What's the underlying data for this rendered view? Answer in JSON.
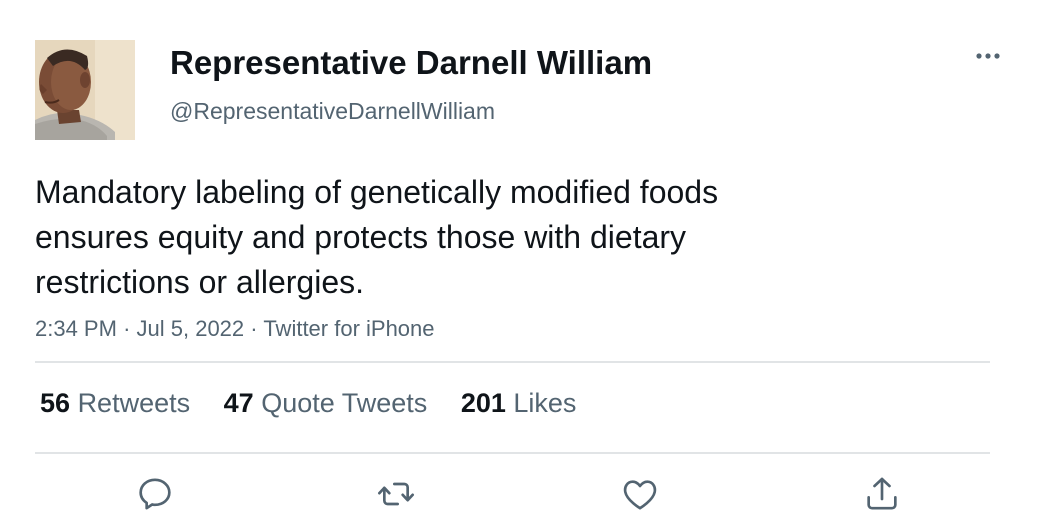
{
  "author": {
    "display_name": "Representative Darnell William",
    "handle": "@RepresentativeDarnellWilliam"
  },
  "tweet": {
    "text": "Mandatory labeling of genetically modified foods ensures equity and protects those with dietary restrictions or allergies.",
    "time": "2:34 PM",
    "separator": "·",
    "date": "Jul 5, 2022",
    "source": "Twitter for iPhone"
  },
  "stats": {
    "retweets_count": "56",
    "retweets_label": "Retweets",
    "quotes_count": "47",
    "quotes_label": "Quote Tweets",
    "likes_count": "201",
    "likes_label": "Likes"
  },
  "actions": [
    "reply-icon",
    "retweet-icon",
    "like-icon",
    "share-icon"
  ],
  "more_icon": "more-options-icon",
  "colors": {
    "text_primary": "#0f1419",
    "text_secondary": "#536471",
    "divider": "#e1e4e6",
    "icon": "#536471"
  }
}
